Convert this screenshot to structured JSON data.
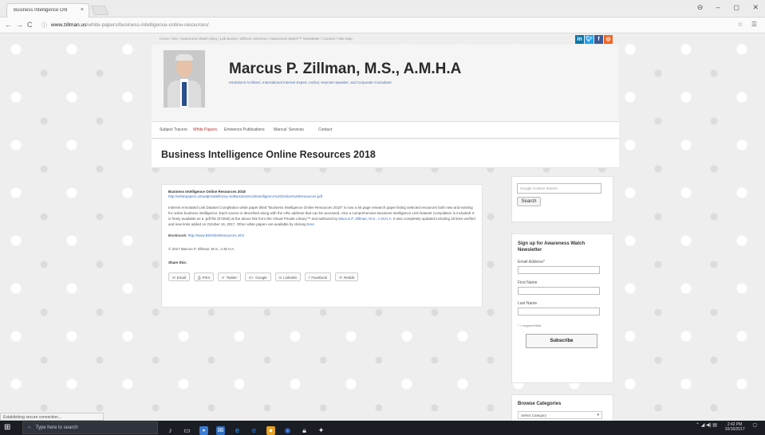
{
  "browser": {
    "tab_title": "Business Intelligence Onl",
    "tab_close": "×",
    "url_host": "www.zillman.us",
    "url_path": "/white-papers/business-intelligence-online-resources/",
    "window_controls": [
      "⊖",
      "–",
      "◻",
      "✕"
    ]
  },
  "site": {
    "top_links": "Home  /  Bio  /  Awareness Watch Blog  /  Lab Books  /  Zillman Universe  /  Awareness Watch™ Newsletter  /  Contact  /  Site Map",
    "name": "Marcus P. Zillman, M.S., A.M.H.A",
    "subtitle": "eSolutions Architect, International Internet Expert, Author, Keynote Speaker, and Corporate Consultant",
    "social": [
      "in",
      "t",
      "f",
      "rss"
    ],
    "nav": [
      "Subject Tracers",
      "White Papers",
      "Eminence Publications",
      "Marcus' Services",
      "Contact"
    ],
    "active_nav": "White Papers"
  },
  "article": {
    "heading": "Business Intelligence Online Resources 2018",
    "sub_title": "Business Intelligence Online Resources 2018",
    "pdf_link": "http://whitepapers.virtualprivatelibrary.net/Business%20Intelligence%20Online%20Resources.pdf",
    "paragraph": "Internet Annotated Link Dataset Compilation white paper titled \"Business Intelligence Online Resources 2018\" is now a 55 page research paper listing selected resources both new and existing for online business intelligence. Each source is described along with the URL address that can be accessed. Also a comprehensive Business Intelligence Link Dataset Compilation is included! It is freely available as a .pdf file (572KB) at the above link from the Virtual Private Library™ and authored by",
    "author_link": "Marcus P. Zillman, M.S., A.M.H.A",
    "paragraph_end": ". It was completely updated including all links verified and new links added on October 16, 2017. Other white papers are available by clicking",
    "here_link": "here",
    "bookmark_label": "Bookmark:",
    "bookmark_url": "http://www.BIOnlineResources.info/",
    "copyright": "© 2017 Marcus P. Zillman, M.S., A.M.H.A.",
    "share_label": "Share this:",
    "share_buttons": [
      {
        "icon": "✉",
        "label": "Email"
      },
      {
        "icon": "⎙",
        "label": "Print"
      },
      {
        "icon": "✔",
        "label": "Twitter"
      },
      {
        "icon": "G+",
        "label": "Google"
      },
      {
        "icon": "in",
        "label": "LinkedIn"
      },
      {
        "icon": "f",
        "label": "Facebook"
      },
      {
        "icon": "⟳",
        "label": "Reddit"
      }
    ]
  },
  "sidebar": {
    "search_placeholder": "Google Custom Search",
    "search_button": "Search",
    "signup_title": "Sign up for Awareness Watch Newsletter",
    "email_label": "Email Address*",
    "first_name_label": "First Name",
    "last_name_label": "Last Name",
    "required_note": "* = required field",
    "subscribe_button": "Subscribe",
    "categories_title": "Browse Categories",
    "categories_selected": "Select Category"
  },
  "status_bar": "Establishing secure connection...",
  "taskbar": {
    "search_placeholder": "Type here to search",
    "time": "2:42 PM",
    "date": "10/16/2017"
  },
  "colors": {
    "linkedin": "#0e76a8",
    "twitter": "#1da1f2",
    "facebook": "#3b5998",
    "rss": "#f26522",
    "active_nav": "#b2312c",
    "link": "#3a6fc0"
  }
}
